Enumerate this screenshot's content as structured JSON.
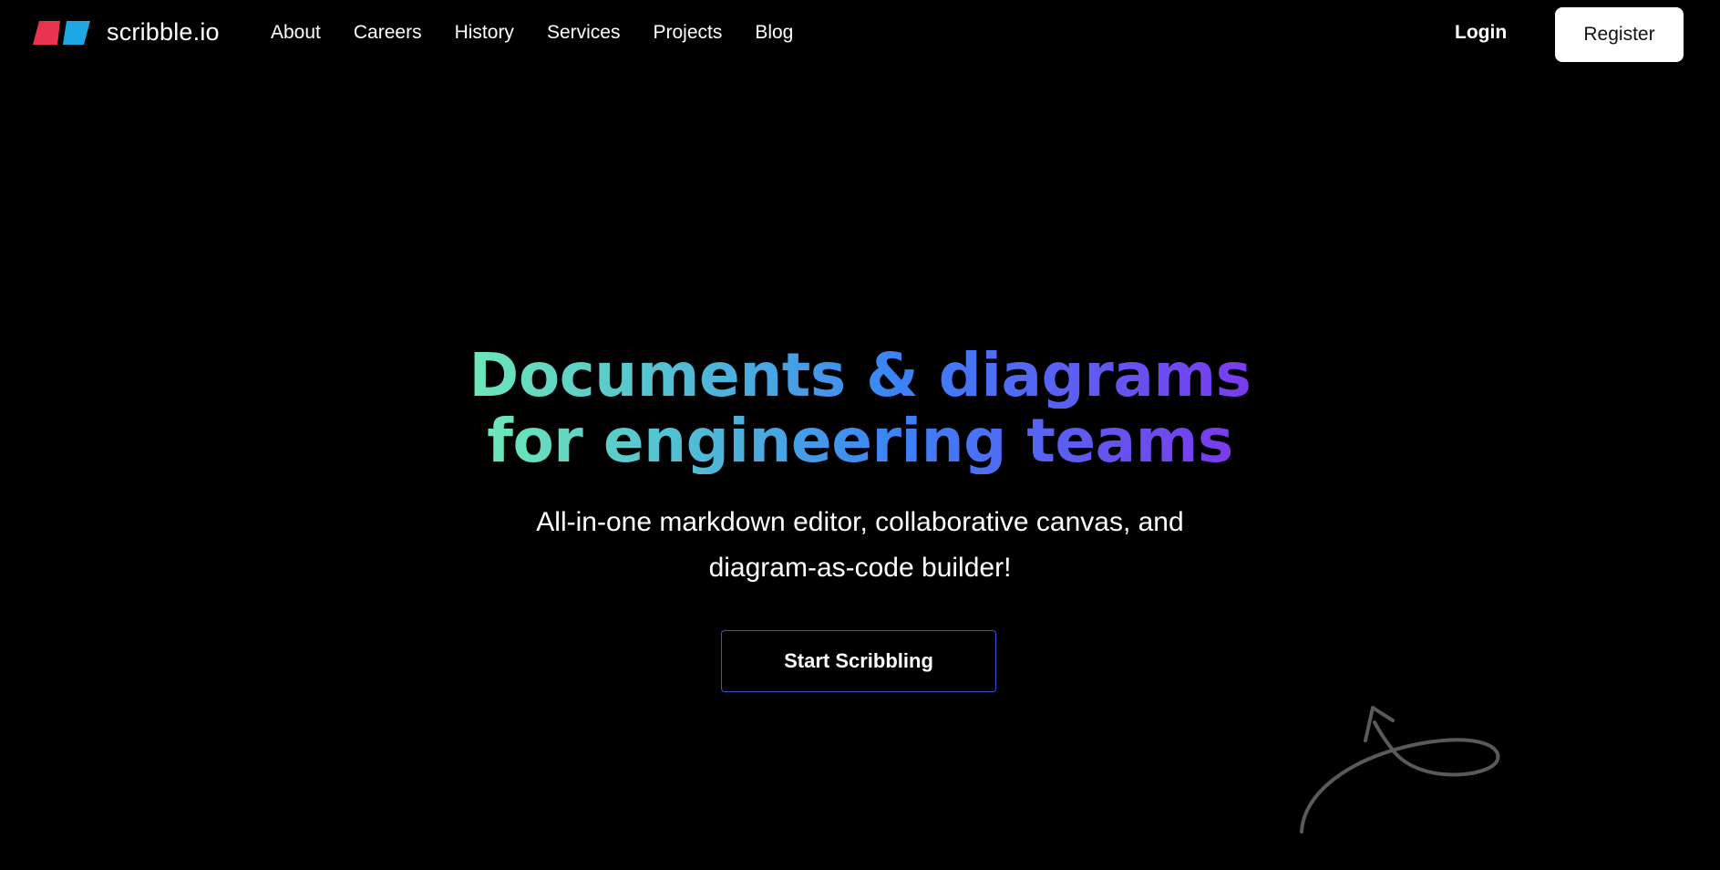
{
  "header": {
    "logo_text": "scribble.io",
    "nav": [
      {
        "label": "About"
      },
      {
        "label": "Careers"
      },
      {
        "label": "History"
      },
      {
        "label": "Services"
      },
      {
        "label": "Projects"
      },
      {
        "label": "Blog"
      }
    ],
    "login_label": "Login",
    "register_label": "Register"
  },
  "hero": {
    "title_line1": "Documents & diagrams",
    "title_line2": "for engineering teams",
    "subtitle_line1": "All-in-one markdown editor, collaborative canvas, and",
    "subtitle_line2": "diagram-as-code builder!",
    "cta_label": "Start Scribbling"
  },
  "colors": {
    "background": "#000000",
    "logo_red": "#e8344e",
    "logo_blue": "#1ea7e4",
    "gradient_start": "#6ee7b7",
    "gradient_mid": "#3b82f6",
    "gradient_end": "#7c3aed",
    "cta_border": "#3b4fd8"
  },
  "icons": {
    "logo": "scribble-logo-icon",
    "doodle": "hand-drawn-arrow-icon"
  }
}
